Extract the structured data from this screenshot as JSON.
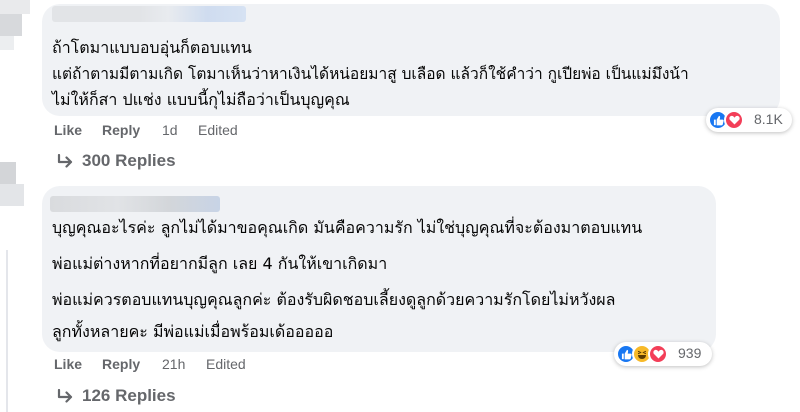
{
  "comments": [
    {
      "lines": [
        "ถ้าโตมาแบบอบอุ่นก็ตอบแทน",
        "แต่ถ้าตามมีตามเกิด โตมาเห็นว่าหาเงินได้หน่อยมาสู บเลือด แล้วก็ใช้คำว่า กูเปียพ่อ เป็นแม่มึงน้า",
        "ไม่ให้ก็สา ปแช่ง แบบนี้กุไม่ถือว่าเป็นบุญคุณ"
      ],
      "actions": {
        "like": "Like",
        "reply": "Reply",
        "time": "1d",
        "edited": "Edited"
      },
      "reaction_count": "8.1K",
      "reaction_icons": [
        "like-icon",
        "love-icon"
      ],
      "replies_label": "300 Replies"
    },
    {
      "lines": [
        "บุญคุณอะไรค่ะ ลูกไม่ได้มาขอคุณเกิด มันคือความรัก ไม่ใช่บุญคุณที่จะต้องมาตอบแทน",
        "พ่อแม่ต่างหากที่อยากมีลูก เลย 4 กันให้เขาเกิดมา",
        "พ่อแม่ควรตอบแทนบุญคุณลูกค่ะ ต้องรับผิดชอบเลี้ยงดูลูกด้วยความรักโดยไม่หวังผล",
        "ลูกทั้งหลายคะ มีพ่อแม่เมื่อพร้อมเด้อออออ"
      ],
      "actions": {
        "like": "Like",
        "reply": "Reply",
        "time": "21h",
        "edited": "Edited"
      },
      "reaction_count": "939",
      "reaction_icons": [
        "like-icon",
        "haha-icon",
        "love-icon"
      ],
      "replies_label": "126 Replies"
    }
  ],
  "colors": {
    "bubble": "#f0f2f5",
    "meta_text": "#65676b",
    "like_blue": "#1877f2",
    "love_red": "#f33e58",
    "haha_yellow": "#f7b928"
  }
}
